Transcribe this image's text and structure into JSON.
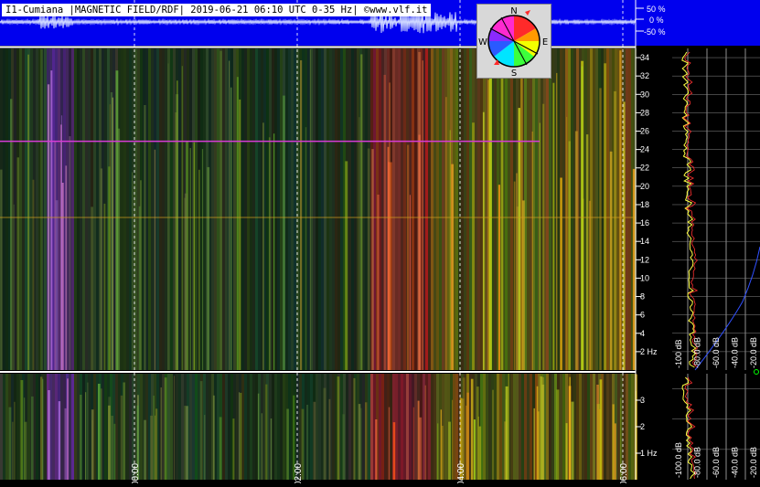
{
  "header": {
    "title": "I1-Cumiana |MAGNETIC FIELD/RDF| 2019-06-21 06:10 UTC 0-35 Hz| ©www.vlf.it"
  },
  "percent_scale": [
    "50 %",
    "0 %",
    "-50 %"
  ],
  "compass": {
    "n": "N",
    "s": "S",
    "e": "E",
    "w": "W"
  },
  "colors": {
    "bg": "#000000",
    "strip_blue": "#0000ee",
    "grid": "#ffffff",
    "tone_line": "#d63cd6"
  },
  "chart_data": [
    {
      "type": "heatmap",
      "name": "spectrogram-upper",
      "y_unit": "Hz",
      "ylim": [
        0,
        35
      ],
      "y_ticks": [
        2,
        4,
        6,
        8,
        10,
        12,
        14,
        16,
        18,
        20,
        22,
        24,
        26,
        28,
        30,
        32,
        34
      ],
      "y_tick_labels": [
        "2 Hz",
        "4",
        "6",
        "8",
        "10",
        "12",
        "14",
        "16",
        "18",
        "20",
        "22",
        "24",
        "26",
        "28",
        "30",
        "32",
        "34"
      ],
      "grid": true
    },
    {
      "type": "heatmap",
      "name": "spectrogram-lower",
      "y_unit": "Hz",
      "ylim": [
        0,
        4
      ],
      "y_ticks": [
        1,
        2,
        3
      ],
      "y_tick_labels": [
        "1 Hz",
        "2",
        "3"
      ],
      "x_ticks": [
        "00:00",
        "02:00",
        "04:00",
        "06:00"
      ],
      "grid": true
    },
    {
      "type": "line",
      "name": "spectrum-upper",
      "xlim": [
        -110,
        -15
      ],
      "x_tick_labels": [
        "-100 dB",
        "-80.0 dB",
        "-60.0 dB",
        "-40.0 dB",
        "-20.0 dB"
      ],
      "grid": true
    },
    {
      "type": "line",
      "name": "spectrum-lower",
      "x_tick_labels": [
        "-100.0 dB",
        "-80.0 dB",
        "-60.0 dB",
        "-40.0 dB",
        "-20.0 dB"
      ],
      "grid": true
    }
  ]
}
